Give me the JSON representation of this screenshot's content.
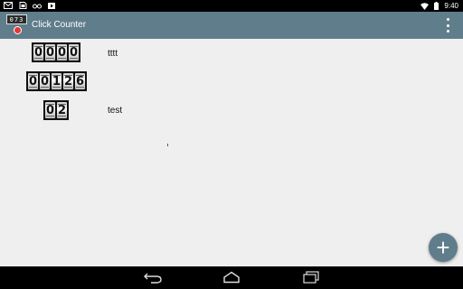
{
  "status_bar": {
    "left_icons": [
      "gmail-icon",
      "sim-card-icon",
      "glasses-icon",
      "play-store-icon"
    ],
    "right_icons": [
      "wifi-icon",
      "battery-icon"
    ],
    "time": "9:40"
  },
  "app_bar": {
    "logo_digits": "073",
    "title": "Click Counter",
    "menu_icon": "overflow-menu-icon"
  },
  "counters": [
    {
      "digits": [
        "0",
        "0",
        "0",
        "0"
      ],
      "label": "tttt"
    },
    {
      "digits": [
        "0",
        "0",
        "1",
        "2",
        "6"
      ],
      "label": ""
    },
    {
      "digits": [
        "0",
        "2"
      ],
      "label": "test"
    }
  ],
  "fab": {
    "icon": "plus-icon",
    "symbol": "+"
  },
  "nav_bar": {
    "buttons": [
      "back-icon",
      "home-icon",
      "recent-apps-icon"
    ]
  },
  "colors": {
    "app_bar": "#607d8b",
    "background": "#efefef",
    "fab": "#607d8b",
    "status_bar": "#000000",
    "nav_bar": "#000000"
  }
}
